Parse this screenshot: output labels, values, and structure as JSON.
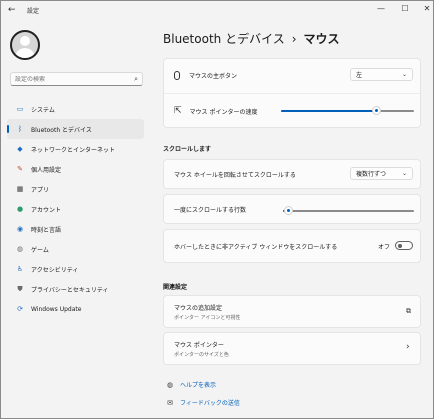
{
  "titlebar": {
    "back_glyph": "←",
    "title": "設定",
    "minimize_glyph": "—",
    "maximize_glyph": "☐",
    "close_glyph": "✕"
  },
  "sidebar": {
    "search_placeholder": "設定の検索",
    "items": [
      {
        "label": "システム",
        "icon": "monitor-icon",
        "glyph": "▭",
        "color": "#1f6fc6"
      },
      {
        "label": "Bluetooth とデバイス",
        "icon": "bluetooth-icon",
        "glyph": "ᛒ",
        "color": "#1f6fc6",
        "selected": true
      },
      {
        "label": "ネットワークとインターネット",
        "icon": "wifi-icon",
        "glyph": "◆",
        "color": "#1f6fc6"
      },
      {
        "label": "個人用設定",
        "icon": "brush-icon",
        "glyph": "✎",
        "color": "#c1502e"
      },
      {
        "label": "アプリ",
        "icon": "apps-icon",
        "glyph": "▦",
        "color": "#3a3a3a"
      },
      {
        "label": "アカウント",
        "icon": "person-icon",
        "glyph": "●",
        "color": "#2e9c6b"
      },
      {
        "label": "時刻と言語",
        "icon": "globe-clock-icon",
        "glyph": "◉",
        "color": "#1f6fc6"
      },
      {
        "label": "ゲーム",
        "icon": "gamepad-icon",
        "glyph": "◍",
        "color": "#6b6b6b"
      },
      {
        "label": "アクセシビリティ",
        "icon": "accessibility-icon",
        "glyph": "♿",
        "color": "#1f6fc6"
      },
      {
        "label": "プライバシーとセキュリティ",
        "icon": "shield-icon",
        "glyph": "⛊",
        "color": "#6b6b6b"
      },
      {
        "label": "Windows Update",
        "icon": "update-icon",
        "glyph": "⟳",
        "color": "#1f6fc6"
      }
    ]
  },
  "main": {
    "breadcrumb_parent": "Bluetooth とデバイス",
    "breadcrumb_sep": "›",
    "breadcrumb_current": "マウス",
    "primary_button": {
      "label": "マウスの主ボタン",
      "value": "左",
      "icon": "mouse-icon"
    },
    "pointer_speed": {
      "label": "マウス ポインターの速度",
      "icon": "pointer-icon",
      "level": 0.72
    },
    "scroll_section_title": "スクロールします",
    "wheel_scroll": {
      "label": "マウス ホイールを回転させてスクロールする",
      "value": "複数行ずつ"
    },
    "lines_per_scroll": {
      "label": "一度にスクロールする行数",
      "level": 0.04
    },
    "inactive_scroll": {
      "label": "ホバーしたときに非アクティブ ウィンドウをスクロールする",
      "state": "オフ"
    },
    "related_section_title": "関連設定",
    "additional_settings": {
      "label": "マウスの追加設定",
      "sub": "ポインター アイコンと可視性",
      "icon": "external-link-icon"
    },
    "mouse_pointer": {
      "label": "マウス ポインター",
      "sub": "ポインターのサイズと色",
      "icon": "chevron-right-icon"
    },
    "help_link": "ヘルプを表示",
    "feedback_link": "フィードバックの送信"
  },
  "colors": {
    "accent": "#005fb8",
    "background": "#f3f3f3",
    "card": "#fbfbfb"
  }
}
